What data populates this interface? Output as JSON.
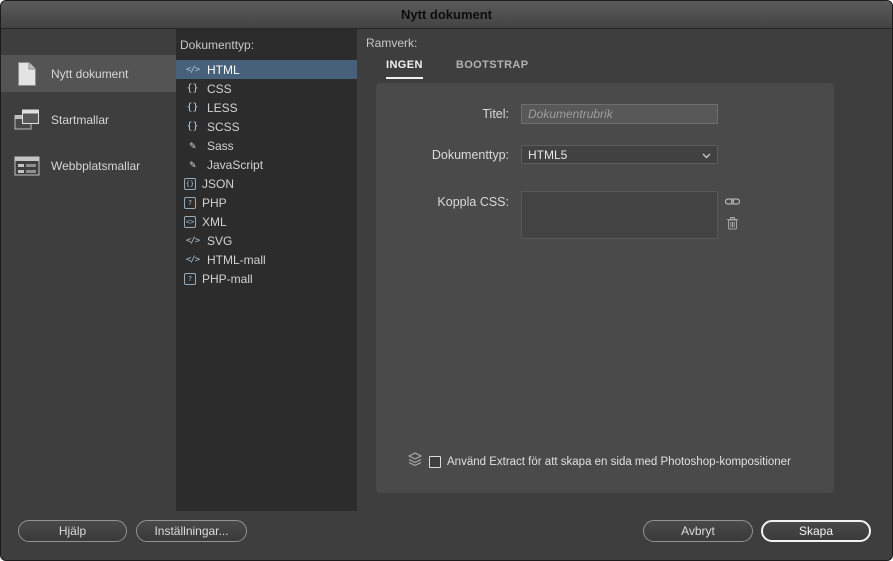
{
  "window": {
    "title": "Nytt dokument"
  },
  "sidebar": {
    "items": [
      {
        "label": "Nytt dokument",
        "icon": "new-document-icon",
        "selected": true
      },
      {
        "label": "Startmallar",
        "icon": "starter-templates-icon",
        "selected": false
      },
      {
        "label": "Webbplatsmallar",
        "icon": "site-templates-icon",
        "selected": false
      }
    ]
  },
  "doctype_list": {
    "header": "Dokumenttyp:",
    "items": [
      {
        "label": "HTML",
        "icon": "code-icon",
        "selected": true
      },
      {
        "label": "CSS",
        "icon": "braces-icon",
        "selected": false
      },
      {
        "label": "LESS",
        "icon": "braces-icon",
        "selected": false
      },
      {
        "label": "SCSS",
        "icon": "braces-icon",
        "selected": false
      },
      {
        "label": "Sass",
        "icon": "pen-icon",
        "selected": false
      },
      {
        "label": "JavaScript",
        "icon": "pen-icon",
        "selected": false
      },
      {
        "label": "JSON",
        "icon": "json-icon",
        "selected": false
      },
      {
        "label": "PHP",
        "icon": "php-icon",
        "selected": false
      },
      {
        "label": "XML",
        "icon": "xml-icon",
        "selected": false
      },
      {
        "label": "SVG",
        "icon": "code-icon",
        "selected": false
      },
      {
        "label": "HTML-mall",
        "icon": "code-icon",
        "selected": false
      },
      {
        "label": "PHP-mall",
        "icon": "php-icon",
        "selected": false
      }
    ]
  },
  "framework": {
    "header": "Ramverk:",
    "tabs": [
      {
        "label": "INGEN",
        "selected": true
      },
      {
        "label": "BOOTSTRAP",
        "selected": false
      }
    ],
    "form": {
      "title_label": "Titel:",
      "title_placeholder": "Dokumentrubrik",
      "title_value": "",
      "doctype_label": "Dokumenttyp:",
      "doctype_value": "HTML5",
      "doctype_chevron": "chevron-down-icon",
      "attach_css_label": "Koppla CSS:",
      "attach_css_icons": [
        "link-icon",
        "trash-icon"
      ],
      "extract_icon": "extract-icon",
      "extract_label": "Använd Extract för att skapa en sida med Photoshop-kompositioner",
      "extract_checked": false
    }
  },
  "footer": {
    "help_label": "Hjälp",
    "preferences_label": "Inställningar...",
    "cancel_label": "Avbryt",
    "create_label": "Skapa"
  },
  "colors": {
    "selection_blue": "#47617a",
    "dialog_bg": "#3e3e3e",
    "list_bg": "#2c2c2c",
    "form_panel_bg": "#4a4a4a"
  }
}
